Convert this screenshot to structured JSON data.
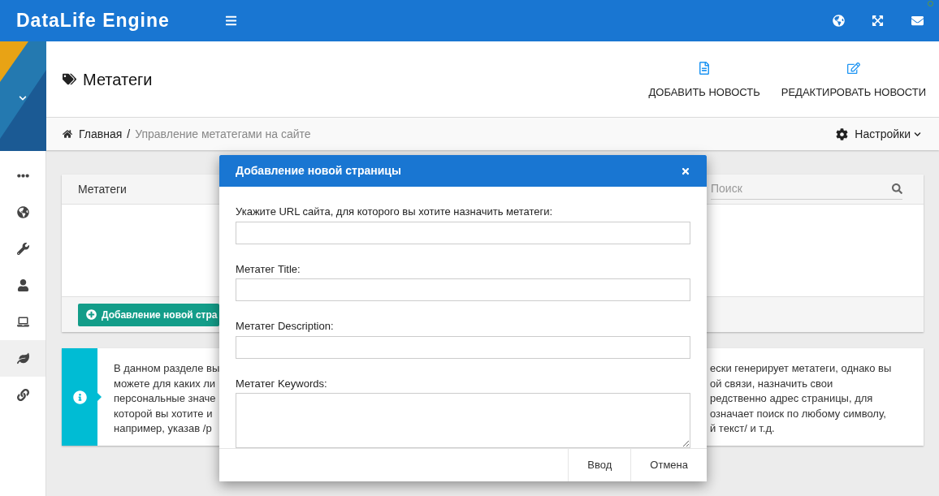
{
  "header": {
    "brand": "DataLife Engine"
  },
  "sidebar": {
    "items": [
      {
        "kind": "dots",
        "selected": false
      },
      {
        "kind": "globe",
        "selected": false
      },
      {
        "kind": "wrench",
        "selected": false
      },
      {
        "kind": "user",
        "selected": false
      },
      {
        "kind": "laptop",
        "selected": false
      },
      {
        "kind": "leaf",
        "selected": true
      },
      {
        "kind": "link",
        "selected": false
      }
    ]
  },
  "page": {
    "title": "Метатеги",
    "actions": [
      {
        "kind": "add",
        "label": "ДОБАВИТЬ НОВОСТЬ"
      },
      {
        "kind": "edit",
        "label": "РЕДАКТИРОВАТЬ НОВОСТИ"
      }
    ]
  },
  "breadcrumb": {
    "items": [
      "Главная",
      "Управление метатегами на сайте"
    ],
    "separator": "/",
    "settings": "Настройки"
  },
  "panel": {
    "title": "Метатеги",
    "search": {
      "placeholder": "Поиск"
    },
    "add_button": "Добавление новой стра"
  },
  "info": {
    "left_lines": [
      "В данном разделе вы",
      "можете для каких ли",
      "персональные значе",
      "которой вы хотите и",
      "например, указав /р"
    ],
    "right_lines": [
      "ески генерирует метатеги, однако вы",
      "ой связи, назначить свои",
      "редственно адрес страницы, для",
      "означает поиск по любому символу,",
      "й текст/ и т.д."
    ]
  },
  "modal": {
    "title": "Добавление новой страницы",
    "fields": [
      {
        "kind": "input",
        "label": "Укажите URL сайта, для которого вы хотите назначить метатеги:"
      },
      {
        "kind": "input",
        "label": "Метатег Title:"
      },
      {
        "kind": "input",
        "label": "Метатег Description:"
      },
      {
        "kind": "textarea",
        "label": "Метатег Keywords:"
      }
    ],
    "buttons": [
      "Ввод",
      "Отмена"
    ]
  }
}
